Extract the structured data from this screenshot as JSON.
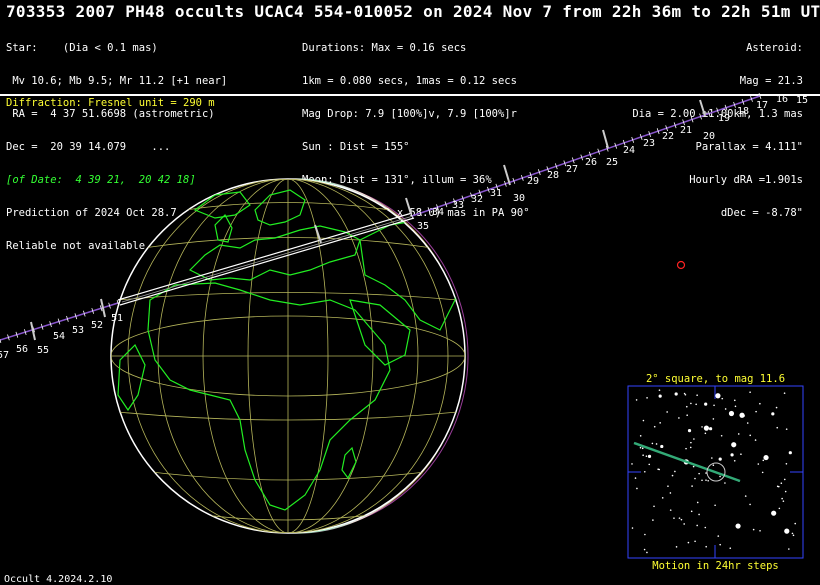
{
  "title": "703353 2007 PH48 occults UCAC4 554-010052 on 2024 Nov  7 from 22h 36m to 22h 51m UT",
  "star": {
    "line1": "Star:    (Dia < 0.1 mas)",
    "line2": " Mv 10.6; Mb 9.5; Mr 11.2 [+1 near]",
    "line3": " RA =  4 37 51.6698 (astrometric)",
    "line4": "Dec =  20 39 14.079    ...",
    "line5": "[of Date:  4 39 21,  20 42 18]",
    "line6": "Prediction of 2024 Oct 28.7",
    "line7": "Reliable not available"
  },
  "event": {
    "line1": "Durations: Max = 0.16 secs",
    "line2": "1km = 0.080 secs, 1mas = 0.12 secs",
    "line3": "Mag Drop: 7.9 [100%]v, 7.9 [100%]r",
    "line4": "Sun : Dist = 155°",
    "line5": "Moon: Dist = 131°, illum = 36%",
    "line6": "1σ Err: ±(78.0 x 58.0) mas in PA 90°"
  },
  "asteroid": {
    "line1": "Asteroid:",
    "line2": "Mag = 21.3",
    "line3": "Dia = 2.00 ±1.00km, 1.3 mas",
    "line4": "Parallax = 4.111\"",
    "line5": "Hourly dRA =1.901s",
    "line6": "dDec = -8.78\""
  },
  "diffraction": "Diffraction: Fresnel unit = 290 m",
  "track_labels": [
    "15",
    "16",
    "17",
    "18",
    "19",
    "20",
    "21",
    "22",
    "23",
    "24",
    "25",
    "26",
    "27",
    "28",
    "29",
    "30",
    "31",
    "32",
    "33",
    "34",
    "35",
    "51",
    "52",
    "53",
    "54",
    "55",
    "56",
    "57"
  ],
  "inset": {
    "title": "2° square, to mag 11.6",
    "caption": "Motion in 24hr steps"
  },
  "version": "Occult 4.2024.2.10",
  "colors": {
    "coastline": "#22ee22",
    "grid": "#b5b55a",
    "track": "#8855cc",
    "label": "#ffff33"
  }
}
